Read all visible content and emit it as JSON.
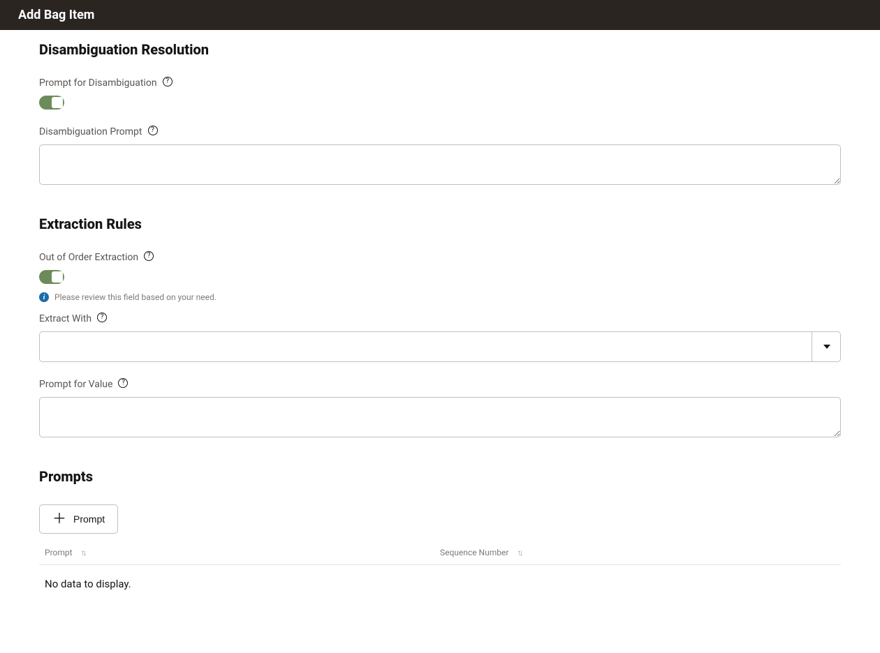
{
  "header": {
    "title": "Add Bag Item"
  },
  "sections": {
    "disambiguation": {
      "heading": "Disambiguation Resolution",
      "prompt_for_disambiguation_label": "Prompt for Disambiguation",
      "disambiguation_prompt_label": "Disambiguation Prompt",
      "disambiguation_prompt_value": ""
    },
    "extraction": {
      "heading": "Extraction Rules",
      "out_of_order_label": "Out of Order Extraction",
      "info_message": "Please review this field based on your need.",
      "extract_with_label": "Extract With",
      "extract_with_value": "",
      "prompt_for_value_label": "Prompt for Value",
      "prompt_for_value_value": ""
    },
    "prompts": {
      "heading": "Prompts",
      "add_button_label": "Prompt",
      "columns": {
        "prompt": "Prompt",
        "sequence_number": "Sequence Number"
      },
      "rows": [],
      "empty_message": "No data to display."
    }
  }
}
